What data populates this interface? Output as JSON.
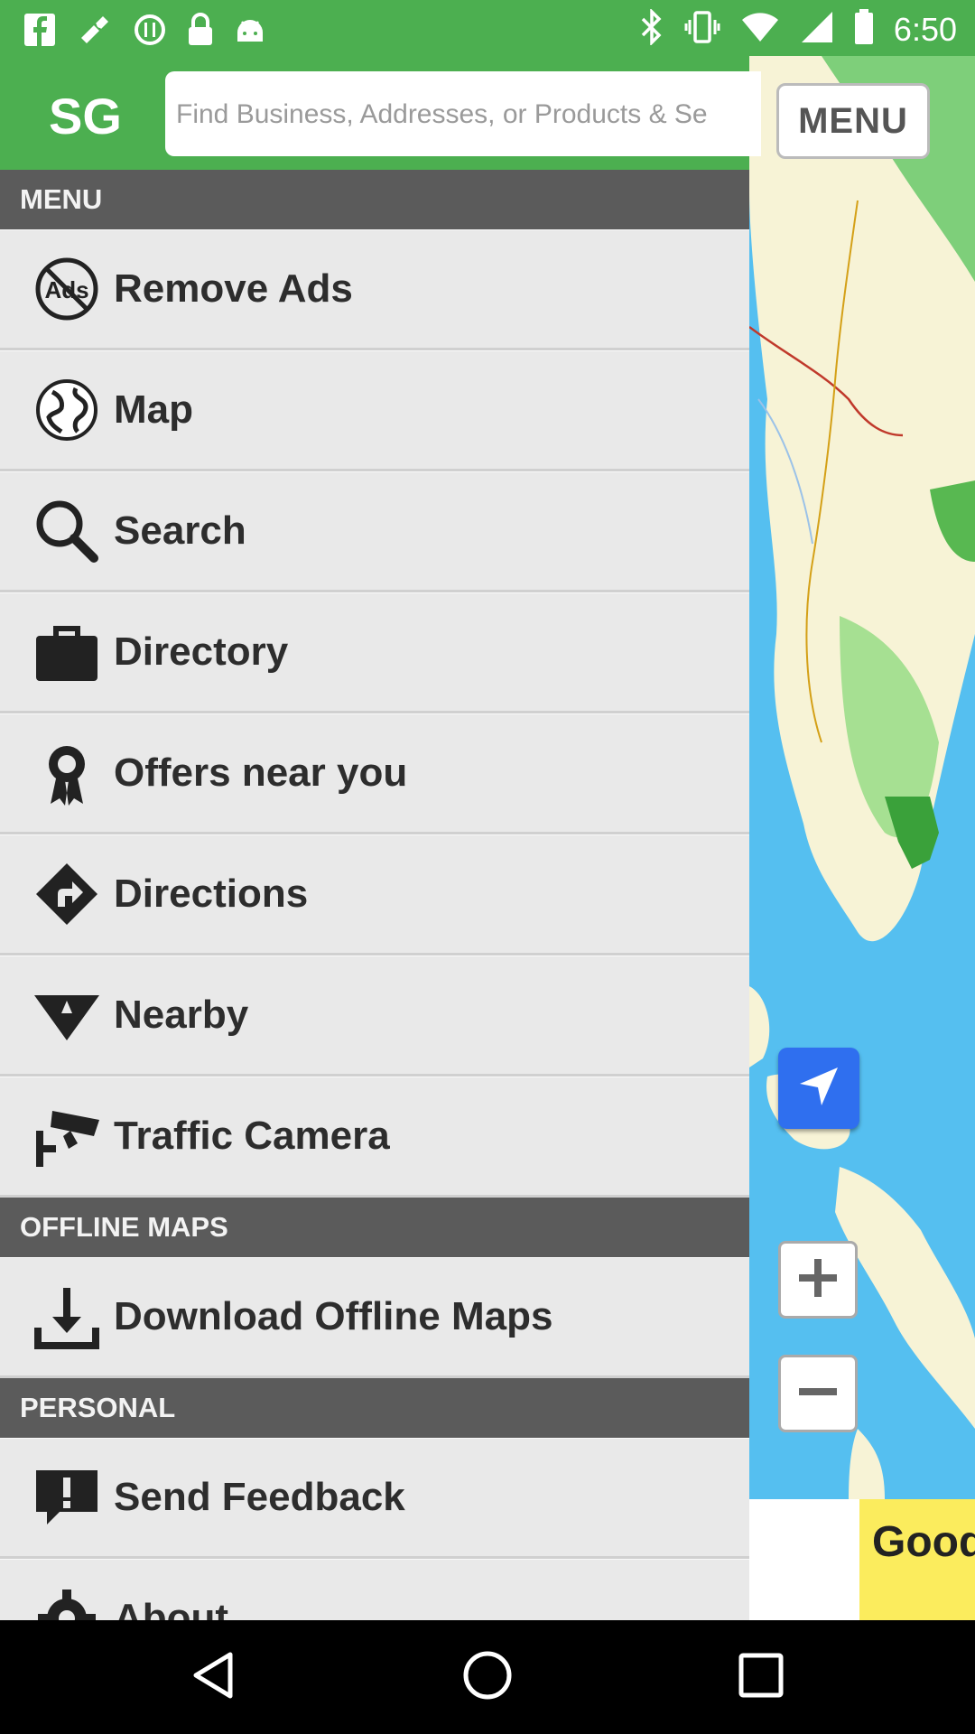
{
  "status_bar": {
    "time": "6:50",
    "left_icons": [
      "facebook-icon",
      "fake-gps-icon",
      "sync-icon",
      "lock-icon",
      "android-icon"
    ],
    "right_icons": [
      "bluetooth-icon",
      "vibrate-icon",
      "wifi-icon",
      "signal-icon",
      "battery-icon"
    ]
  },
  "header": {
    "logo": "SG",
    "search_placeholder": "Find Business, Addresses, or Products & Se",
    "menu_label": "MENU"
  },
  "drawer": {
    "menu_header": "MENU",
    "menu_items": [
      {
        "label": "Remove Ads",
        "icon": "no-ads-icon"
      },
      {
        "label": "Map",
        "icon": "globe-icon"
      },
      {
        "label": "Search",
        "icon": "search-icon"
      },
      {
        "label": "Directory",
        "icon": "briefcase-icon"
      },
      {
        "label": "Offers near you",
        "icon": "award-ribbon-icon"
      },
      {
        "label": "Directions",
        "icon": "turn-sign-icon"
      },
      {
        "label": "Nearby",
        "icon": "nearby-triangle-icon"
      },
      {
        "label": "Traffic Camera",
        "icon": "cctv-camera-icon"
      }
    ],
    "offline_header": "OFFLINE MAPS",
    "offline_items": [
      {
        "label": "Download Offline Maps",
        "icon": "download-icon"
      }
    ],
    "personal_header": "PERSONAL",
    "personal_items": [
      {
        "label": "Send Feedback",
        "icon": "feedback-icon"
      },
      {
        "label": "About",
        "icon": "gear-icon"
      }
    ]
  },
  "map": {
    "controls": [
      "locate-icon",
      "zoom-in-icon",
      "zoom-out-icon"
    ]
  },
  "ad": {
    "text": "Good"
  },
  "colors": {
    "brand_green": "#4caf50",
    "section_gray": "#5b5b5b",
    "drawer_bg": "#e9e9e9",
    "water_blue": "#55bff0",
    "locate_blue": "#2f6fef",
    "ad_yellow": "#fbec5d"
  }
}
